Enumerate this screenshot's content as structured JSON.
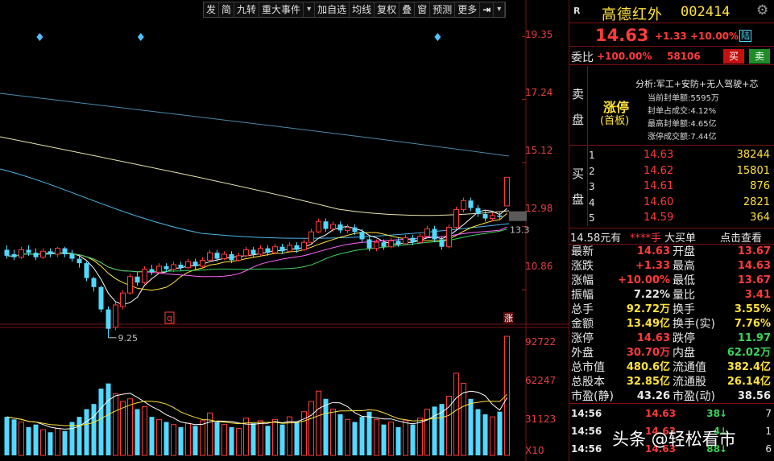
{
  "toolbar": {
    "items": [
      "发",
      "简",
      "九转",
      "重大事件",
      "▾",
      "加自选",
      "均线",
      "复权",
      "叠",
      "窗",
      "预测",
      "更多",
      "⇥",
      "▾"
    ]
  },
  "stock": {
    "badge": "R",
    "name": "高德红外",
    "code": "002414",
    "price": "14.63",
    "change": "+1.33",
    "change_pct": "+10.00%",
    "tag": "陆",
    "weibi_label": "委比",
    "weibi_value": "+100.00%",
    "weicha": "58106",
    "sell_btn": "买",
    "buy_btn": "卖"
  },
  "limit_info": {
    "sell_label": [
      "卖",
      "盘"
    ],
    "zt_label": "涨停",
    "zt_sub": "(首板)",
    "analysis": "分析:军工+安防+无人驾驶+芯",
    "lines": [
      "当前封单额:5595万",
      "封单占成交:4.12%",
      "最高封单额:4.65亿",
      "涨停成交额:7.44亿"
    ]
  },
  "buy_book": {
    "label": [
      "买",
      "盘"
    ],
    "rows": [
      {
        "level": "1",
        "price": "14.63",
        "volume": "38244"
      },
      {
        "level": "2",
        "price": "14.62",
        "volume": "15801"
      },
      {
        "level": "3",
        "price": "14.61",
        "volume": "876"
      },
      {
        "level": "4",
        "price": "14.60",
        "volume": "2821"
      },
      {
        "level": "5",
        "price": "14.59",
        "volume": "364"
      }
    ]
  },
  "summary_row": {
    "left": "14.58元有",
    "mid": "****手",
    "mid2": "大买单",
    "right": "点击查看"
  },
  "quote": [
    {
      "k1": "最新",
      "v1": "14.63",
      "c1": "red",
      "k2": "开盘",
      "v2": "13.67",
      "c2": "red"
    },
    {
      "k1": "涨跌",
      "v1": "+1.33",
      "c1": "red",
      "k2": "最高",
      "v2": "14.63",
      "c2": "red"
    },
    {
      "k1": "涨幅",
      "v1": "+10.00%",
      "c1": "red",
      "k2": "最低",
      "v2": "13.67",
      "c2": "red"
    },
    {
      "k1": "振幅",
      "v1": "7.22%",
      "c1": "white",
      "k2": "量比",
      "v2": "3.41",
      "c2": "red"
    },
    {
      "k1": "总手",
      "v1": "92.72万",
      "c1": "yellow",
      "k2": "换手",
      "v2": "3.55%",
      "c2": "yellow"
    },
    {
      "k1": "金额",
      "v1": "13.49亿",
      "c1": "yellow",
      "k2": "换手(实)",
      "v2": "7.76%",
      "c2": "yellow"
    },
    {
      "k1": "涨停",
      "v1": "14.63",
      "c1": "red",
      "k2": "跌停",
      "v2": "11.97",
      "c2": "green"
    },
    {
      "k1": "外盘",
      "v1": "30.70万",
      "c1": "red",
      "k2": "内盘",
      "v2": "62.02万",
      "c2": "green"
    },
    {
      "k1": "总市值",
      "v1": "480.6亿",
      "c1": "yellow",
      "k2": "流通值",
      "v2": "382.4亿",
      "c2": "yellow"
    },
    {
      "k1": "总股本",
      "v1": "32.85亿",
      "c1": "yellow",
      "k2": "流通股",
      "v2": "26.14亿",
      "c2": "yellow"
    },
    {
      "k1": "市盈(静)",
      "v1": "43.26",
      "c1": "white",
      "k2": "市盈(动)",
      "v2": "38.56",
      "c2": "white"
    }
  ],
  "ticks": [
    {
      "time": "14:56",
      "price": "14.63",
      "vol": "38",
      "dir": "↓",
      "n": "7"
    },
    {
      "time": "14:56",
      "price": "14.63",
      "vol": "4",
      "dir": "↓",
      "n": "1"
    },
    {
      "time": "14:56",
      "price": "14.63",
      "vol": "88",
      "dir": "↓",
      "n": "6"
    }
  ],
  "watermark": "头条 @轻松看市",
  "chart_data": {
    "type": "candlestick",
    "price_axis": {
      "ticks": [
        "19.35",
        "17.24",
        "15.12",
        "12.98",
        "10.86"
      ],
      "ylim": [
        10.0,
        19.9
      ]
    },
    "volume_axis": {
      "ticks": [
        "92722",
        "62247",
        "31123"
      ],
      "unit": "X10",
      "ylim": [
        0,
        99000
      ]
    },
    "annotations": {
      "low_label": "9.25",
      "last_label": "13.3",
      "mark_q": "q",
      "mark_zt": "涨"
    },
    "diamonds": [
      13,
      46,
      143
    ],
    "candles": [
      {
        "o": 12.2,
        "c": 12.0,
        "h": 12.35,
        "l": 11.9,
        "v": 30000
      },
      {
        "o": 12.05,
        "c": 11.95,
        "h": 12.2,
        "l": 11.85,
        "v": 28000
      },
      {
        "o": 11.95,
        "c": 12.2,
        "h": 12.3,
        "l": 11.9,
        "v": 26000
      },
      {
        "o": 12.2,
        "c": 12.1,
        "h": 12.35,
        "l": 12.0,
        "v": 22000
      },
      {
        "o": 12.1,
        "c": 11.95,
        "h": 12.25,
        "l": 11.85,
        "v": 24000
      },
      {
        "o": 11.95,
        "c": 12.15,
        "h": 12.25,
        "l": 11.9,
        "v": 20000
      },
      {
        "o": 12.15,
        "c": 12.05,
        "h": 12.25,
        "l": 11.95,
        "v": 18000
      },
      {
        "o": 12.05,
        "c": 12.25,
        "h": 12.3,
        "l": 11.95,
        "v": 21000
      },
      {
        "o": 12.25,
        "c": 12.05,
        "h": 12.3,
        "l": 11.95,
        "v": 19000
      },
      {
        "o": 12.05,
        "c": 11.9,
        "h": 12.2,
        "l": 11.8,
        "v": 26000
      },
      {
        "o": 11.9,
        "c": 11.75,
        "h": 12.0,
        "l": 11.6,
        "v": 30000
      },
      {
        "o": 11.75,
        "c": 11.25,
        "h": 11.8,
        "l": 11.15,
        "v": 36000
      },
      {
        "o": 11.25,
        "c": 10.95,
        "h": 11.3,
        "l": 10.8,
        "v": 40000
      },
      {
        "o": 10.95,
        "c": 10.2,
        "h": 11.0,
        "l": 10.1,
        "v": 52000
      },
      {
        "o": 10.2,
        "c": 9.55,
        "h": 10.3,
        "l": 9.25,
        "v": 56000
      },
      {
        "o": 9.6,
        "c": 10.35,
        "h": 10.45,
        "l": 9.5,
        "v": 48000
      },
      {
        "o": 10.3,
        "c": 10.75,
        "h": 10.85,
        "l": 10.2,
        "v": 42000
      },
      {
        "o": 10.75,
        "c": 11.3,
        "h": 11.4,
        "l": 10.7,
        "v": 44000
      },
      {
        "o": 11.3,
        "c": 11.1,
        "h": 11.45,
        "l": 11.0,
        "v": 36000
      },
      {
        "o": 11.1,
        "c": 11.55,
        "h": 11.65,
        "l": 11.05,
        "v": 38000
      },
      {
        "o": 11.55,
        "c": 11.45,
        "h": 11.7,
        "l": 11.35,
        "v": 30000
      },
      {
        "o": 11.45,
        "c": 11.65,
        "h": 11.75,
        "l": 11.4,
        "v": 28000
      },
      {
        "o": 11.65,
        "c": 11.55,
        "h": 11.75,
        "l": 11.45,
        "v": 26000
      },
      {
        "o": 11.55,
        "c": 11.7,
        "h": 11.8,
        "l": 11.45,
        "v": 24000
      },
      {
        "o": 11.7,
        "c": 11.6,
        "h": 11.8,
        "l": 11.5,
        "v": 22000
      },
      {
        "o": 11.6,
        "c": 11.8,
        "h": 11.9,
        "l": 11.55,
        "v": 25000
      },
      {
        "o": 11.8,
        "c": 11.65,
        "h": 11.9,
        "l": 11.55,
        "v": 23000
      },
      {
        "o": 11.65,
        "c": 11.85,
        "h": 11.95,
        "l": 11.6,
        "v": 27000
      },
      {
        "o": 11.85,
        "c": 12.1,
        "h": 12.2,
        "l": 11.8,
        "v": 33000
      },
      {
        "o": 12.1,
        "c": 11.9,
        "h": 12.2,
        "l": 11.8,
        "v": 26000
      },
      {
        "o": 11.9,
        "c": 12.05,
        "h": 12.15,
        "l": 11.85,
        "v": 24000
      },
      {
        "o": 12.05,
        "c": 11.85,
        "h": 12.15,
        "l": 11.75,
        "v": 22000
      },
      {
        "o": 11.85,
        "c": 12.0,
        "h": 12.1,
        "l": 11.8,
        "v": 21000
      },
      {
        "o": 12.0,
        "c": 12.2,
        "h": 12.3,
        "l": 11.95,
        "v": 29000
      },
      {
        "o": 12.2,
        "c": 12.05,
        "h": 12.3,
        "l": 11.95,
        "v": 25000
      },
      {
        "o": 12.05,
        "c": 12.25,
        "h": 12.35,
        "l": 12.0,
        "v": 27000
      },
      {
        "o": 12.25,
        "c": 12.1,
        "h": 12.35,
        "l": 12.0,
        "v": 23000
      },
      {
        "o": 12.1,
        "c": 12.3,
        "h": 12.4,
        "l": 12.05,
        "v": 28000
      },
      {
        "o": 12.3,
        "c": 12.15,
        "h": 12.4,
        "l": 12.05,
        "v": 24000
      },
      {
        "o": 12.15,
        "c": 12.35,
        "h": 12.45,
        "l": 12.1,
        "v": 30000
      },
      {
        "o": 12.35,
        "c": 12.2,
        "h": 12.45,
        "l": 12.1,
        "v": 26000
      },
      {
        "o": 12.2,
        "c": 12.45,
        "h": 12.55,
        "l": 12.15,
        "v": 34000
      },
      {
        "o": 12.45,
        "c": 12.8,
        "h": 12.9,
        "l": 12.4,
        "v": 42000
      },
      {
        "o": 12.8,
        "c": 13.15,
        "h": 13.25,
        "l": 12.75,
        "v": 50000
      },
      {
        "o": 13.15,
        "c": 12.9,
        "h": 13.25,
        "l": 12.8,
        "v": 44000
      },
      {
        "o": 12.9,
        "c": 13.05,
        "h": 13.15,
        "l": 12.8,
        "v": 36000
      },
      {
        "o": 13.05,
        "c": 12.85,
        "h": 13.15,
        "l": 12.75,
        "v": 32000
      },
      {
        "o": 12.85,
        "c": 12.95,
        "h": 13.05,
        "l": 12.75,
        "v": 28000
      },
      {
        "o": 12.95,
        "c": 12.8,
        "h": 13.05,
        "l": 12.7,
        "v": 26000
      },
      {
        "o": 12.8,
        "c": 12.55,
        "h": 12.9,
        "l": 12.45,
        "v": 30000
      },
      {
        "o": 12.55,
        "c": 12.25,
        "h": 12.65,
        "l": 12.15,
        "v": 34000
      },
      {
        "o": 12.25,
        "c": 12.45,
        "h": 12.55,
        "l": 12.15,
        "v": 28000
      },
      {
        "o": 12.45,
        "c": 12.3,
        "h": 12.55,
        "l": 12.2,
        "v": 24000
      },
      {
        "o": 12.3,
        "c": 12.5,
        "h": 12.6,
        "l": 12.25,
        "v": 26000
      },
      {
        "o": 12.5,
        "c": 12.4,
        "h": 12.6,
        "l": 12.3,
        "v": 22000
      },
      {
        "o": 12.4,
        "c": 12.6,
        "h": 12.7,
        "l": 12.35,
        "v": 27000
      },
      {
        "o": 12.6,
        "c": 12.45,
        "h": 12.7,
        "l": 12.35,
        "v": 24000
      },
      {
        "o": 12.45,
        "c": 12.65,
        "h": 12.75,
        "l": 12.4,
        "v": 29000
      },
      {
        "o": 12.65,
        "c": 12.9,
        "h": 13.0,
        "l": 12.6,
        "v": 36000
      },
      {
        "o": 12.9,
        "c": 12.55,
        "h": 13.0,
        "l": 12.45,
        "v": 38000
      },
      {
        "o": 12.55,
        "c": 12.3,
        "h": 12.65,
        "l": 12.2,
        "v": 40000
      },
      {
        "o": 12.3,
        "c": 12.95,
        "h": 13.05,
        "l": 12.25,
        "v": 46000
      },
      {
        "o": 12.95,
        "c": 13.55,
        "h": 13.65,
        "l": 12.9,
        "v": 64000
      },
      {
        "o": 13.55,
        "c": 13.85,
        "h": 13.95,
        "l": 13.45,
        "v": 56000
      },
      {
        "o": 13.85,
        "c": 13.6,
        "h": 13.95,
        "l": 13.5,
        "v": 44000
      },
      {
        "o": 13.6,
        "c": 13.4,
        "h": 13.7,
        "l": 13.3,
        "v": 36000
      },
      {
        "o": 13.4,
        "c": 13.25,
        "h": 13.5,
        "l": 13.15,
        "v": 32000
      },
      {
        "o": 13.25,
        "c": 13.35,
        "h": 13.45,
        "l": 13.15,
        "v": 30000
      },
      {
        "o": 13.35,
        "c": 13.3,
        "h": 13.45,
        "l": 13.2,
        "v": 34000
      },
      {
        "o": 13.67,
        "c": 14.63,
        "h": 14.63,
        "l": 13.67,
        "v": 92722
      }
    ]
  }
}
